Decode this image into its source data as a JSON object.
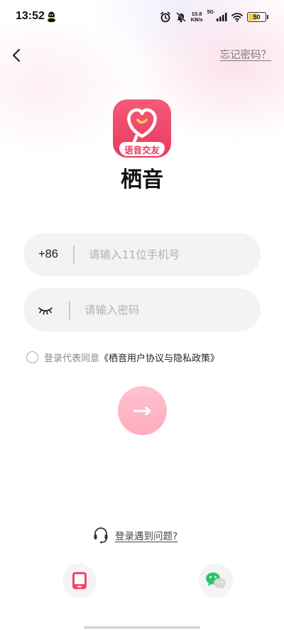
{
  "status_bar": {
    "time": "13:52",
    "net_speed_value": "10.8",
    "net_speed_unit": "KB/s",
    "network_type": "5G",
    "battery": "50",
    "battery_color": "#e9d04c",
    "icons": [
      "qq-icon",
      "alarm-icon",
      "mute-icon",
      "signal-icon",
      "wifi-icon",
      "battery-icon"
    ]
  },
  "nav": {
    "back_icon": "chevron-left-icon",
    "forgot_password": "忘记密码？"
  },
  "app": {
    "logo_caption": "语音交友",
    "name": "栖音",
    "brand_color": "#e83a5e"
  },
  "login_form": {
    "country_code": "+86",
    "phone_placeholder": "请输入11位手机号",
    "phone_value": "",
    "password_placeholder": "请输入密码",
    "password_value": "",
    "password_toggle_icon": "eye-closed-icon"
  },
  "agreement": {
    "checked": false,
    "prefix": "登录代表同意",
    "link": "《栖音用户协议与隐私政策》"
  },
  "submit": {
    "icon": "arrow-right-icon",
    "color": "#fdacbd"
  },
  "help": {
    "icon": "headset-icon",
    "label": "登录遇到问题?"
  },
  "third_party": {
    "items": [
      {
        "name": "phone-login",
        "icon": "phone-icon"
      },
      {
        "name": "wechat-login",
        "icon": "wechat-icon"
      }
    ]
  }
}
